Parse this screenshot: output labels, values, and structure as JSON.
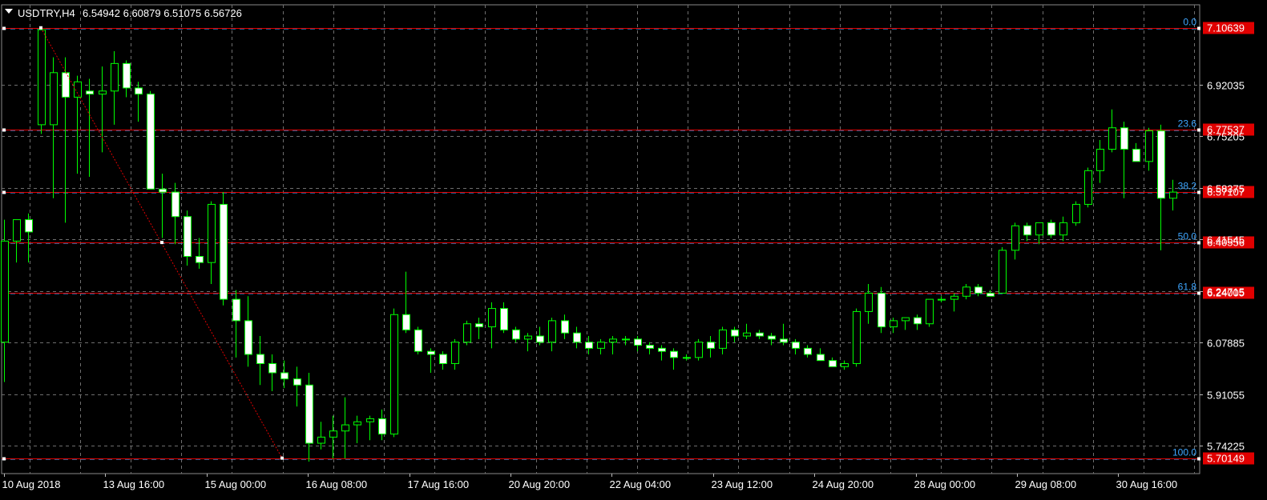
{
  "header": {
    "symbol": "USDTRY,H4",
    "ohlc": "6.54942 6.60879 6.51075 6.56726"
  },
  "colors": {
    "background": "#000000",
    "grid": "#6e6e6e",
    "bull_body": "#000000",
    "bear_body": "#ffffff",
    "candle_outline": "#00ff00",
    "fib_line": "#e00000",
    "fib_label": "#3ea6ff",
    "price_tag": "#e00000"
  },
  "chart_data": {
    "type": "candlestick",
    "symbol": "USDTRY",
    "timeframe": "H4",
    "y_axis_ticks": [
      "6.92035",
      "6.75205",
      "6.58375",
      "6.41545",
      "6.24715",
      "6.07885",
      "5.91055",
      "5.74225"
    ],
    "x_axis_ticks": [
      "10 Aug 2018",
      "13 Aug 16:00",
      "15 Aug 00:00",
      "16 Aug 08:00",
      "17 Aug 16:00",
      "20 Aug 20:00",
      "22 Aug 04:00",
      "23 Aug 12:00",
      "24 Aug 20:00",
      "28 Aug 00:00",
      "29 Aug 08:00",
      "30 Aug 16:00"
    ],
    "ylim": [
      5.68,
      7.15
    ],
    "fibonacci": {
      "high": 7.10639,
      "low": 5.70149,
      "levels": [
        {
          "ratio": "0.0",
          "price": "7.10639"
        },
        {
          "ratio": "23.6",
          "price": "6.77537"
        },
        {
          "ratio": "38.2",
          "price": "6.57107"
        },
        {
          "ratio": "50.0",
          "price": "6.40556"
        },
        {
          "ratio": "61.8",
          "price": "6.24005"
        },
        {
          "ratio": "100.0",
          "price": "5.70149"
        }
      ]
    },
    "candles": [
      [
        6.08,
        6.48,
        5.95,
        6.41
      ],
      [
        6.41,
        6.48,
        6.34,
        6.48
      ],
      [
        6.48,
        6.5,
        6.34,
        6.44
      ],
      [
        6.79,
        7.1,
        6.76,
        7.1
      ],
      [
        6.79,
        7.01,
        6.55,
        6.96
      ],
      [
        6.96,
        7.01,
        6.47,
        6.88
      ],
      [
        6.88,
        6.95,
        6.63,
        6.93
      ],
      [
        6.9,
        6.94,
        6.62,
        6.89
      ],
      [
        6.89,
        6.98,
        6.7,
        6.9
      ],
      [
        6.9,
        7.03,
        6.79,
        6.99
      ],
      [
        6.99,
        7.0,
        6.88,
        6.91
      ],
      [
        6.91,
        6.93,
        6.8,
        6.89
      ],
      [
        6.89,
        6.9,
        6.59,
        6.58
      ],
      [
        6.58,
        6.63,
        6.42,
        6.57
      ],
      [
        6.57,
        6.6,
        6.4,
        6.49
      ],
      [
        6.49,
        6.51,
        6.33,
        6.36
      ],
      [
        6.36,
        6.42,
        6.32,
        6.34
      ],
      [
        6.34,
        6.54,
        6.27,
        6.53
      ],
      [
        6.53,
        6.57,
        6.2,
        6.22
      ],
      [
        6.22,
        6.25,
        6.03,
        6.15
      ],
      [
        6.15,
        6.23,
        6.0,
        6.04
      ],
      [
        6.04,
        6.1,
        5.94,
        6.01
      ],
      [
        6.01,
        6.04,
        5.92,
        5.98
      ],
      [
        5.98,
        6.02,
        5.93,
        5.96
      ],
      [
        5.96,
        6.0,
        5.87,
        5.94
      ],
      [
        5.94,
        5.98,
        5.69,
        5.75
      ],
      [
        5.75,
        5.82,
        5.73,
        5.77
      ],
      [
        5.77,
        5.84,
        5.7,
        5.79
      ],
      [
        5.79,
        5.9,
        5.7,
        5.81
      ],
      [
        5.81,
        5.84,
        5.75,
        5.82
      ],
      [
        5.82,
        5.84,
        5.76,
        5.83
      ],
      [
        5.83,
        5.86,
        5.76,
        5.78
      ],
      [
        5.78,
        6.19,
        5.77,
        6.17
      ],
      [
        6.17,
        6.31,
        6.11,
        6.12
      ],
      [
        6.12,
        6.13,
        6.04,
        6.05
      ],
      [
        6.05,
        6.06,
        5.98,
        6.04
      ],
      [
        6.04,
        6.05,
        5.99,
        6.01
      ],
      [
        6.01,
        6.09,
        5.99,
        6.08
      ],
      [
        6.08,
        6.15,
        6.07,
        6.14
      ],
      [
        6.14,
        6.16,
        6.09,
        6.13
      ],
      [
        6.13,
        6.21,
        6.06,
        6.19
      ],
      [
        6.19,
        6.21,
        6.11,
        6.12
      ],
      [
        6.12,
        6.13,
        6.08,
        6.09
      ],
      [
        6.09,
        6.11,
        6.05,
        6.1
      ],
      [
        6.1,
        6.13,
        6.07,
        6.08
      ],
      [
        6.08,
        6.16,
        6.05,
        6.15
      ],
      [
        6.15,
        6.17,
        6.09,
        6.11
      ],
      [
        6.11,
        6.13,
        6.06,
        6.08
      ],
      [
        6.08,
        6.1,
        6.04,
        6.06
      ],
      [
        6.06,
        6.09,
        6.04,
        6.08
      ],
      [
        6.08,
        6.1,
        6.04,
        6.09
      ],
      [
        6.09,
        6.1,
        6.07,
        6.09
      ],
      [
        6.09,
        6.1,
        6.05,
        6.07
      ],
      [
        6.07,
        6.08,
        6.04,
        6.06
      ],
      [
        6.06,
        6.07,
        6.02,
        6.05
      ],
      [
        6.05,
        6.06,
        5.99,
        6.03
      ],
      [
        6.03,
        6.04,
        6.02,
        6.03
      ],
      [
        6.03,
        6.09,
        6.02,
        6.08
      ],
      [
        6.08,
        6.1,
        6.03,
        6.06
      ],
      [
        6.06,
        6.13,
        6.04,
        6.12
      ],
      [
        6.12,
        6.13,
        6.08,
        6.1
      ],
      [
        6.1,
        6.14,
        6.09,
        6.11
      ],
      [
        6.11,
        6.12,
        6.09,
        6.1
      ],
      [
        6.1,
        6.11,
        6.07,
        6.09
      ],
      [
        6.09,
        6.14,
        6.07,
        6.08
      ],
      [
        6.08,
        6.09,
        6.04,
        6.06
      ],
      [
        6.06,
        6.07,
        6.03,
        6.04
      ],
      [
        6.04,
        6.06,
        6.02,
        6.02
      ],
      [
        6.02,
        6.03,
        6.0,
        6.0
      ],
      [
        6.0,
        6.02,
        5.99,
        6.01
      ],
      [
        6.01,
        6.19,
        6.0,
        6.18
      ],
      [
        6.18,
        6.27,
        6.14,
        6.24
      ],
      [
        6.24,
        6.26,
        6.11,
        6.13
      ],
      [
        6.13,
        6.16,
        6.11,
        6.15
      ],
      [
        6.15,
        6.16,
        6.12,
        6.16
      ],
      [
        6.16,
        6.17,
        6.12,
        6.14
      ],
      [
        6.14,
        6.22,
        6.13,
        6.22
      ],
      [
        6.22,
        6.23,
        6.21,
        6.22
      ],
      [
        6.22,
        6.24,
        6.18,
        6.23
      ],
      [
        6.23,
        6.27,
        6.22,
        6.26
      ],
      [
        6.26,
        6.27,
        6.23,
        6.24
      ],
      [
        6.24,
        6.25,
        6.23,
        6.23
      ],
      [
        6.24,
        6.39,
        6.24,
        6.38
      ],
      [
        6.38,
        6.47,
        6.35,
        6.46
      ],
      [
        6.46,
        6.47,
        6.41,
        6.43
      ],
      [
        6.43,
        6.47,
        6.4,
        6.47
      ],
      [
        6.47,
        6.48,
        6.42,
        6.43
      ],
      [
        6.43,
        6.49,
        6.41,
        6.47
      ],
      [
        6.47,
        6.54,
        6.46,
        6.53
      ],
      [
        6.53,
        6.65,
        6.52,
        6.64
      ],
      [
        6.64,
        6.74,
        6.6,
        6.71
      ],
      [
        6.71,
        6.84,
        6.7,
        6.78
      ],
      [
        6.78,
        6.8,
        6.55,
        6.71
      ],
      [
        6.71,
        6.73,
        6.68,
        6.67
      ],
      [
        6.67,
        6.78,
        6.64,
        6.77
      ],
      [
        6.77,
        6.79,
        6.38,
        6.55
      ],
      [
        6.55,
        6.61,
        6.51,
        6.57
      ]
    ]
  }
}
